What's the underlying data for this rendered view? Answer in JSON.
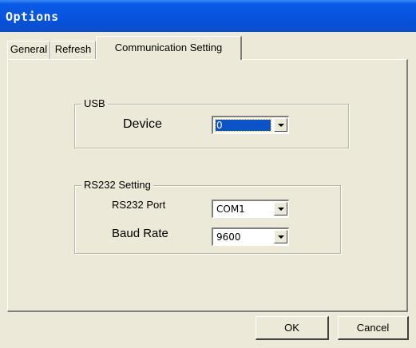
{
  "window": {
    "title": "Options"
  },
  "tabs": [
    {
      "label": "General"
    },
    {
      "label": "Refresh"
    },
    {
      "label": "Communication Setting"
    }
  ],
  "active_tab": "Communication Setting",
  "usb": {
    "legend": "USB",
    "device_label": "Device",
    "device_value": "0"
  },
  "rs232": {
    "legend": "RS232 Setting",
    "port_label": "RS232 Port",
    "port_value": "COM1",
    "baud_label": "Baud Rate",
    "baud_value": "9600"
  },
  "buttons": {
    "ok": "OK",
    "cancel": "Cancel"
  },
  "icons": {
    "dropdown": "chevron-down-icon"
  },
  "colors": {
    "titlebar": "#0652de",
    "selection": "#0a54c8",
    "dialog_bg": "#ece9d8"
  }
}
